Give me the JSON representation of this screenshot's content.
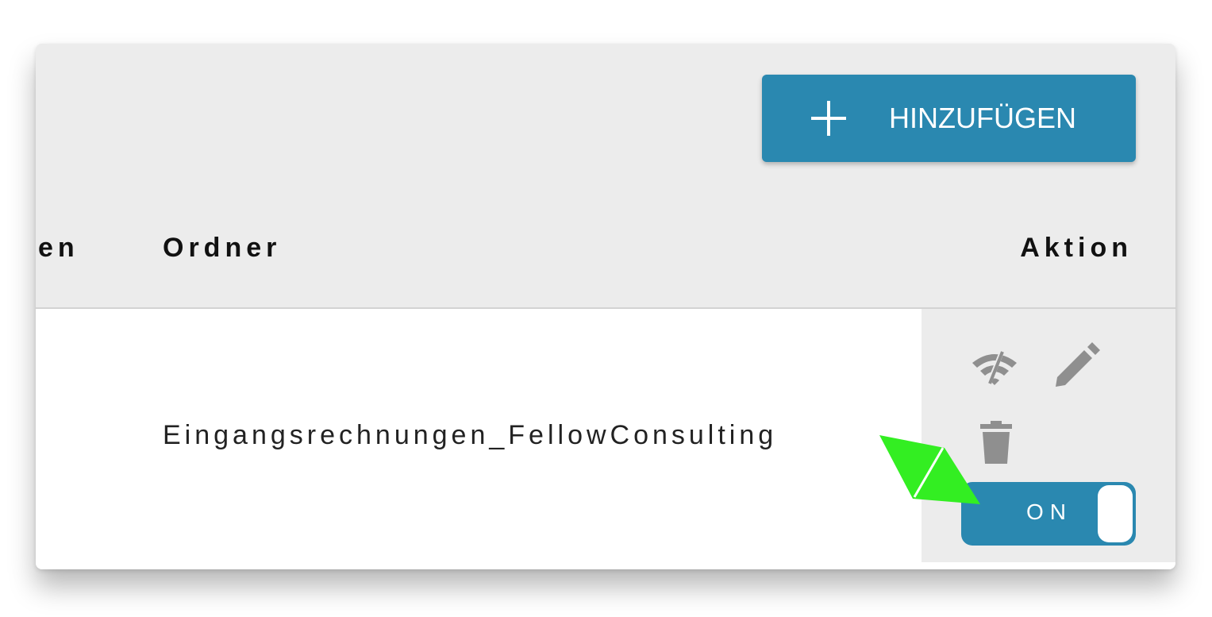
{
  "toolbar": {
    "add_label": "HINZUFÜGEN",
    "add_icon": "plus-icon"
  },
  "table": {
    "columns": [
      {
        "label": "en"
      },
      {
        "label": "Ordner"
      },
      {
        "label": "Aktion"
      }
    ],
    "rows": [
      {
        "ordner": "Eingangsrechnungen_FellowConsulting",
        "actions": {
          "icons": [
            "wifi-off-icon",
            "pencil-icon",
            "trash-icon"
          ],
          "toggle_label": "ON",
          "toggle_state": "on"
        }
      }
    ]
  },
  "colors": {
    "accent": "#2a88b0",
    "panel": "#ececec",
    "icon": "#8f8f8f",
    "cursor": "#33ee22"
  }
}
